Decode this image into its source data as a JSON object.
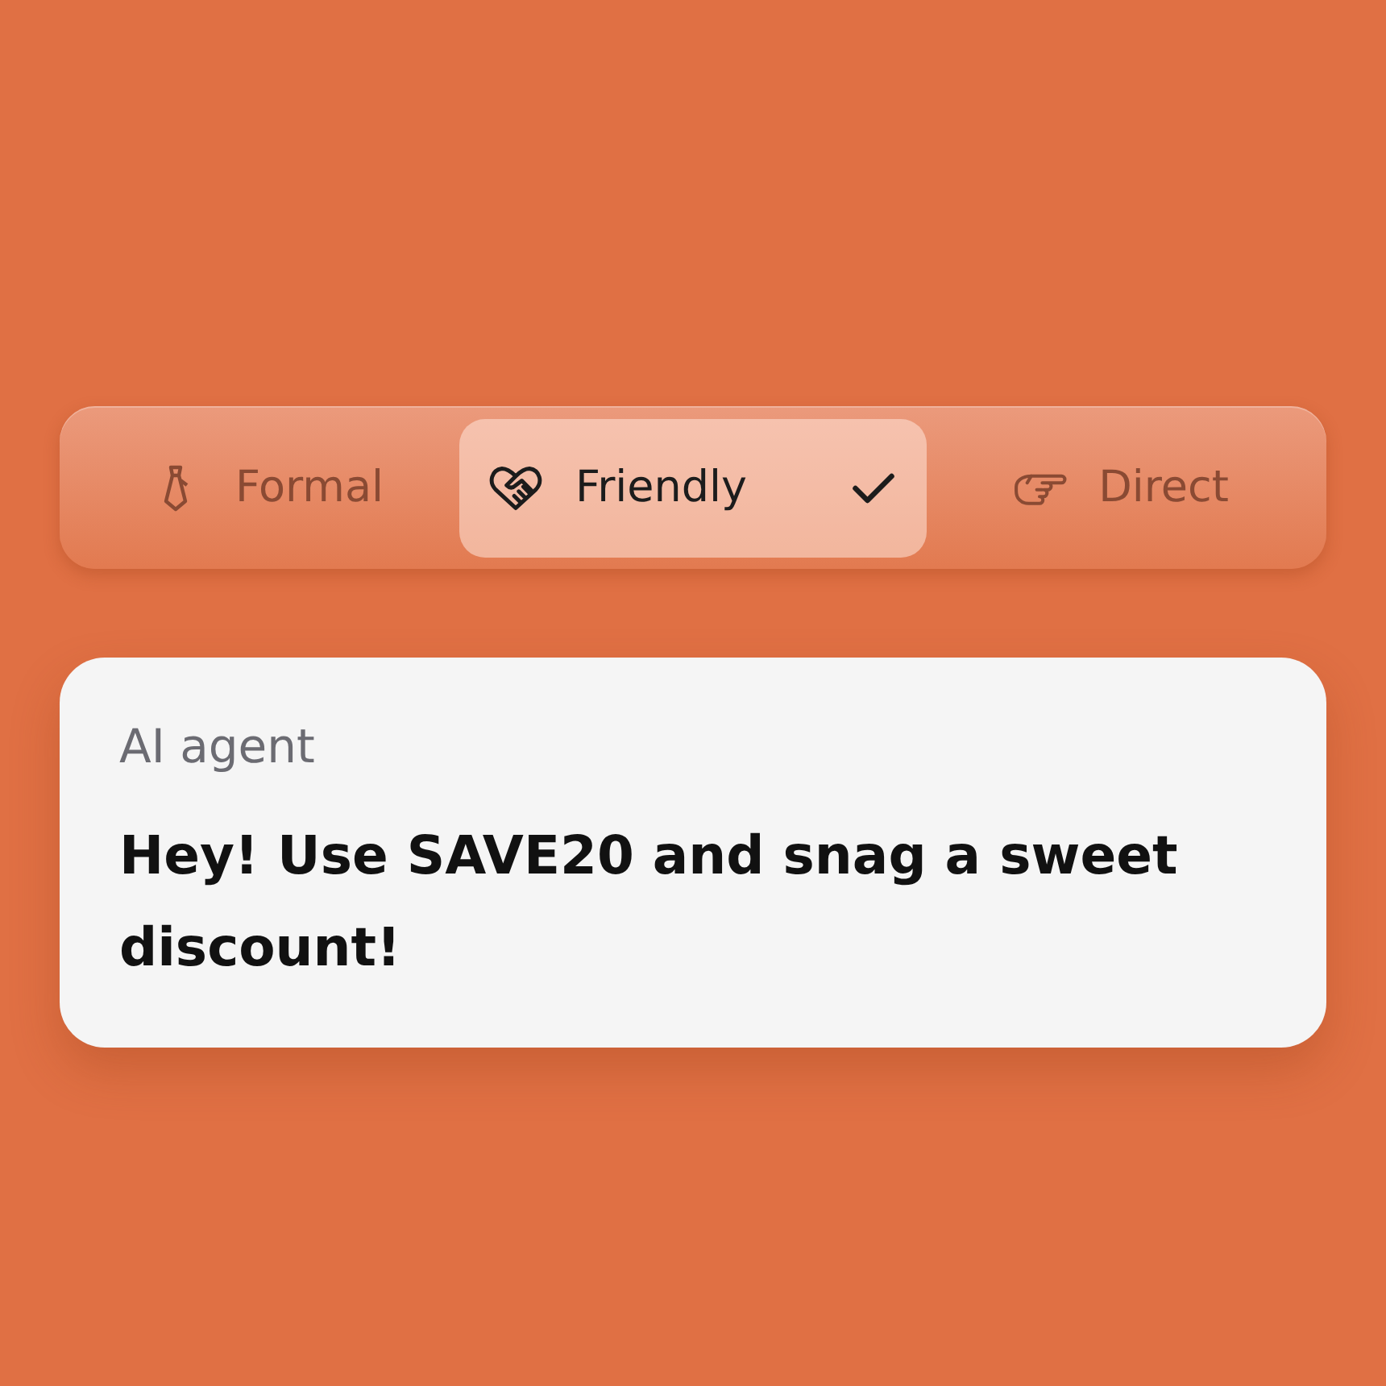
{
  "tone_tabs": [
    {
      "label": "Formal",
      "selected": false
    },
    {
      "label": "Friendly",
      "selected": true
    },
    {
      "label": "Direct",
      "selected": false
    }
  ],
  "message": {
    "sender": "AI agent",
    "text": "Hey! Use SAVE20 and snag a sweet discount!"
  }
}
